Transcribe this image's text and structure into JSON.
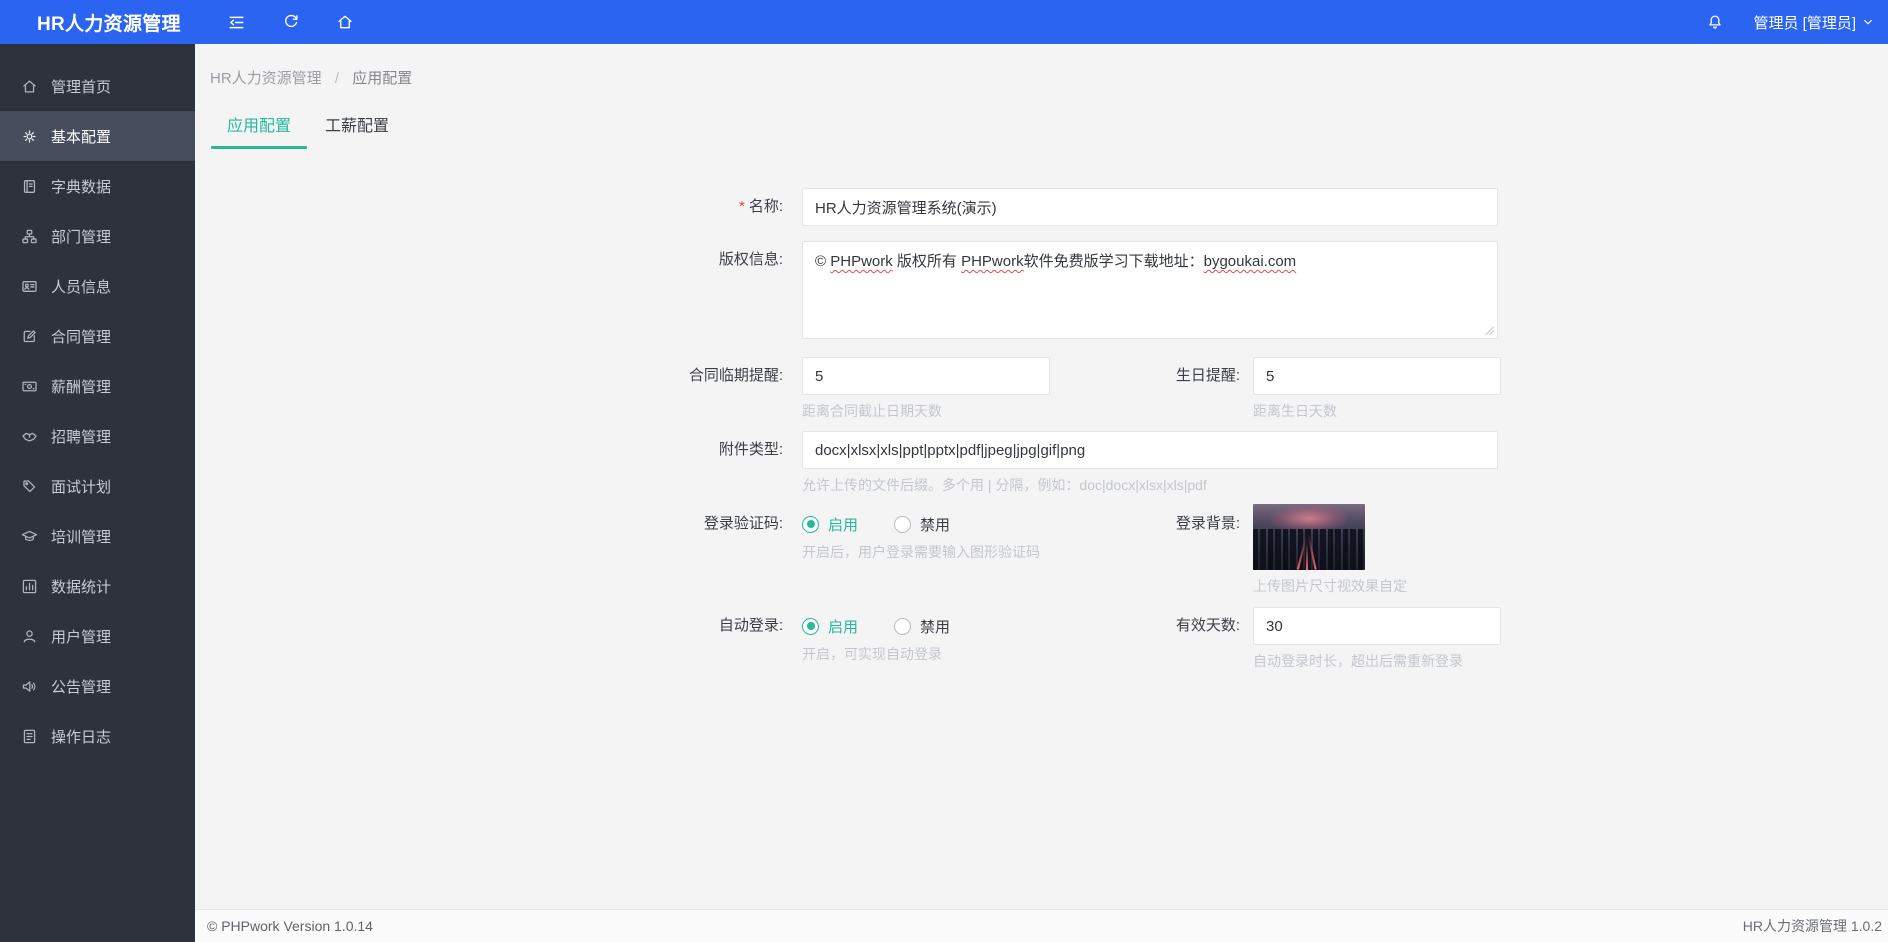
{
  "topbar": {
    "title": "HR人力资源管理",
    "user": "管理员 [管理员]"
  },
  "sidebar": {
    "items": [
      {
        "label": "管理首页",
        "icon": "home-icon",
        "active": false
      },
      {
        "label": "基本配置",
        "icon": "gear-icon",
        "active": true
      },
      {
        "label": "字典数据",
        "icon": "book-icon",
        "active": false
      },
      {
        "label": "部门管理",
        "icon": "sitemap-icon",
        "active": false
      },
      {
        "label": "人员信息",
        "icon": "idcard-icon",
        "active": false
      },
      {
        "label": "合同管理",
        "icon": "contract-icon",
        "active": false
      },
      {
        "label": "薪酬管理",
        "icon": "money-icon",
        "active": false
      },
      {
        "label": "招聘管理",
        "icon": "handshake-icon",
        "active": false
      },
      {
        "label": "面试计划",
        "icon": "interview-icon",
        "active": false
      },
      {
        "label": "培训管理",
        "icon": "training-icon",
        "active": false
      },
      {
        "label": "数据统计",
        "icon": "chart-icon",
        "active": false
      },
      {
        "label": "用户管理",
        "icon": "user-icon",
        "active": false
      },
      {
        "label": "公告管理",
        "icon": "announcement-icon",
        "active": false
      },
      {
        "label": "操作日志",
        "icon": "log-icon",
        "active": false
      }
    ]
  },
  "breadcrumb": {
    "root": "HR人力资源管理",
    "separator": "/",
    "current": "应用配置"
  },
  "tabs": [
    {
      "label": "应用配置",
      "active": true
    },
    {
      "label": "工薪配置",
      "active": false
    }
  ],
  "form": {
    "name": {
      "required_mark": "*",
      "label": "名称:",
      "value": "HR人力资源管理系统(演示)"
    },
    "copyright": {
      "label": "版权信息:",
      "segments": [
        {
          "text": "© ",
          "misspelled": false
        },
        {
          "text": "PHPwork",
          "misspelled": true
        },
        {
          "text": " 版权所有 ",
          "misspelled": false
        },
        {
          "text": "PHPwork",
          "misspelled": true
        },
        {
          "text": "软件免费版学习下载地址：",
          "misspelled": false
        },
        {
          "text": "bygoukai.com",
          "misspelled": true
        }
      ]
    },
    "contract_reminder": {
      "label": "合同临期提醒:",
      "value": "5",
      "help": "距离合同截止日期天数"
    },
    "birthday_reminder": {
      "label": "生日提醒:",
      "value": "5",
      "help": "距离生日天数"
    },
    "attachment_types": {
      "label": "附件类型:",
      "value": "docx|xlsx|xls|ppt|pptx|pdf|jpeg|jpg|gif|png",
      "help": "允许上传的文件后缀。多个用 | 分隔，例如：doc|docx|xlsx|xls|pdf"
    },
    "captcha": {
      "label": "登录验证码:",
      "option_enable": "启用",
      "option_disable": "禁用",
      "selected": "启用",
      "help": "开启后，用户登录需要输入图形验证码"
    },
    "login_background": {
      "label": "登录背景:",
      "help": "上传图片尺寸视效果自定"
    },
    "auto_login": {
      "label": "自动登录:",
      "option_enable": "启用",
      "option_disable": "禁用",
      "selected": "启用",
      "help": "开启，可实现自动登录"
    },
    "valid_days": {
      "label": "有效天数:",
      "value": "30",
      "help": "自动登录时长，超出后需重新登录"
    }
  },
  "footer": {
    "left": "© PHPwork Version 1.0.14",
    "right": "HR人力资源管理 1.0.2"
  },
  "colors": {
    "topbar_blue": "#2b64f0",
    "sidebar_dark": "#2d323d",
    "sidebar_active": "#464d5c",
    "accent_teal": "#26b99a",
    "required_red": "#f04134",
    "spellcheck_red": "#e5484d"
  }
}
